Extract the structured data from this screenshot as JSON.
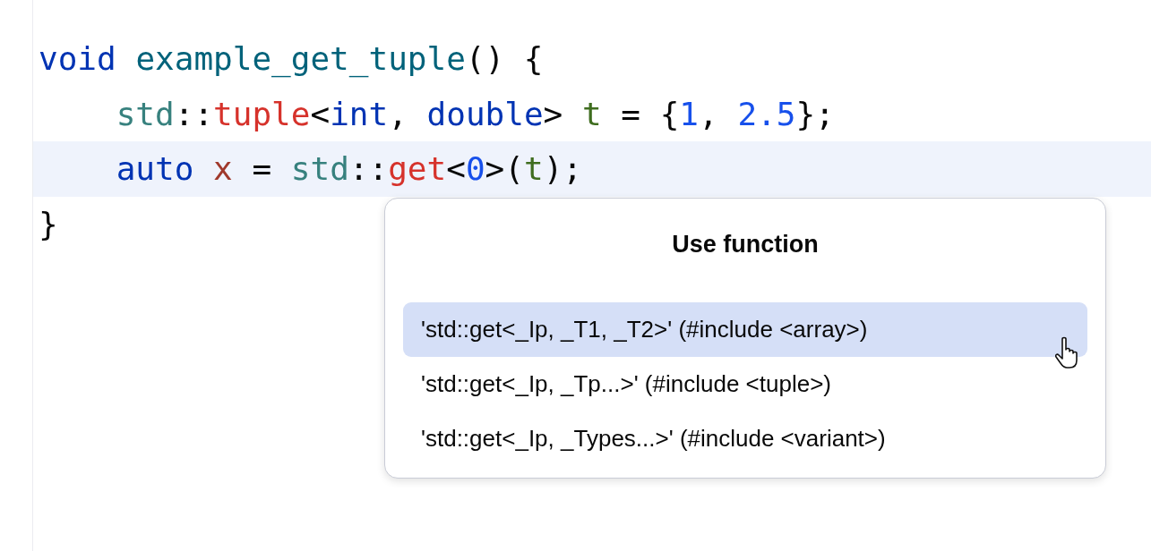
{
  "editor": {
    "lines": [
      {
        "current": false,
        "tokens": [
          {
            "text": "void",
            "kind": "keyword"
          },
          {
            "text": " example_get_tuple",
            "kind": "function"
          },
          {
            "text": "() {",
            "kind": "plain"
          }
        ]
      },
      {
        "current": false,
        "tokens": [
          {
            "text": "    std",
            "kind": "namespace"
          },
          {
            "text": "::",
            "kind": "plain"
          },
          {
            "text": "tuple",
            "kind": "template"
          },
          {
            "text": "<",
            "kind": "plain"
          },
          {
            "text": "int",
            "kind": "keyword"
          },
          {
            "text": ", ",
            "kind": "plain"
          },
          {
            "text": "double",
            "kind": "keyword"
          },
          {
            "text": "> ",
            "kind": "plain"
          },
          {
            "text": "t",
            "kind": "local"
          },
          {
            "text": " = {",
            "kind": "plain"
          },
          {
            "text": "1",
            "kind": "number"
          },
          {
            "text": ", ",
            "kind": "plain"
          },
          {
            "text": "2.5",
            "kind": "number"
          },
          {
            "text": "};",
            "kind": "plain"
          }
        ]
      },
      {
        "current": true,
        "tokens": [
          {
            "text": "    auto",
            "kind": "keyword"
          },
          {
            "text": " x",
            "kind": "variable"
          },
          {
            "text": " = ",
            "kind": "plain"
          },
          {
            "text": "std",
            "kind": "namespace"
          },
          {
            "text": "::",
            "kind": "plain"
          },
          {
            "text": "get",
            "kind": "template"
          },
          {
            "text": "<",
            "kind": "plain"
          },
          {
            "text": "0",
            "kind": "number"
          },
          {
            "text": ">(",
            "kind": "plain"
          },
          {
            "text": "t",
            "kind": "local"
          },
          {
            "text": ");",
            "kind": "plain"
          }
        ]
      },
      {
        "current": false,
        "tokens": [
          {
            "text": "}",
            "kind": "plain"
          }
        ]
      }
    ]
  },
  "popup": {
    "title": "Use function",
    "items": [
      {
        "label": "'std::get<_Ip, _T1, _T2>' (#include <array>)",
        "selected": true
      },
      {
        "label": "'std::get<_Ip, _Tp...>' (#include <tuple>)",
        "selected": false
      },
      {
        "label": "'std::get<_Ip, _Types...>' (#include <variant>)",
        "selected": false
      }
    ]
  }
}
